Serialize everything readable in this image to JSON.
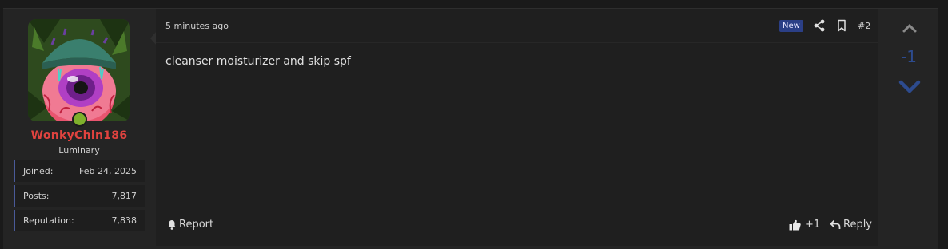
{
  "user": {
    "name": "WonkyChin186",
    "title": "Luminary",
    "online": true,
    "stats": [
      {
        "label": "Joined:",
        "value": "Feb 24, 2025"
      },
      {
        "label": "Posts:",
        "value": "7,817"
      },
      {
        "label": "Reputation:",
        "value": "7,838"
      }
    ]
  },
  "post": {
    "time": "5 minutes ago",
    "badge": "New",
    "number": "#2",
    "body": "cleanser moisturizer and skip spf",
    "actions": {
      "report": "Report",
      "like": "+1",
      "reply": "Reply"
    },
    "icons": {
      "share": "share-icon",
      "bookmark": "bookmark-icon",
      "report": "bell-icon",
      "like": "thumbs-up-icon",
      "reply": "reply-arrow-icon"
    }
  },
  "vote": {
    "score": "-1"
  },
  "colors": {
    "username": "#e0433f",
    "online": "#7fb02c",
    "badge_bg": "#2b3f86",
    "vote_score": "#2d4b8e",
    "stat_accent": "#4a5a98"
  }
}
